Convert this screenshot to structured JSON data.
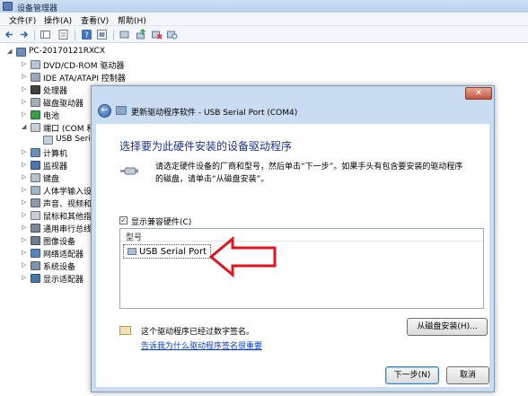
{
  "window": {
    "title": "设备管理器"
  },
  "menu": {
    "items": [
      "文件(F)",
      "操作(A)",
      "查看(V)",
      "帮助(H)"
    ]
  },
  "tree": {
    "root": "PC-20170121RXCX",
    "items": [
      {
        "label": "DVD/CD-ROM 驱动器",
        "expander": "▷"
      },
      {
        "label": "IDE ATA/ATAPI 控制器",
        "expander": "▷"
      },
      {
        "label": "处理器",
        "expander": "▷"
      },
      {
        "label": "磁盘驱动器",
        "expander": "▷"
      },
      {
        "label": "电池",
        "expander": "▷"
      },
      {
        "label": "端口 (COM 和",
        "expander": "◢"
      },
      {
        "label": "USB Seri",
        "expander": "",
        "child": true
      },
      {
        "label": "计算机",
        "expander": "▷"
      },
      {
        "label": "监视器",
        "expander": "▷"
      },
      {
        "label": "键盘",
        "expander": "▷"
      },
      {
        "label": "人体学输入设",
        "expander": "▷"
      },
      {
        "label": "声音、视频和",
        "expander": "▷"
      },
      {
        "label": "鼠标和其他指",
        "expander": "▷"
      },
      {
        "label": "通用串行总线",
        "expander": "▷"
      },
      {
        "label": "图像设备",
        "expander": "▷"
      },
      {
        "label": "网络适配器",
        "expander": "▷"
      },
      {
        "label": "系统设备",
        "expander": "▷"
      },
      {
        "label": "显示适配器",
        "expander": "▷"
      }
    ]
  },
  "dialog": {
    "close_glyph": "✕",
    "back_glyph": "←",
    "title": "更新驱动程序软件 - USB Serial Port (COM4)",
    "heading": "选择要为此硬件安装的设备驱动程序",
    "instruction": "请选定硬件设备的厂商和型号，然后单击“下一步”。如果手头有包含要安装的驱动程序的磁盘，请单击“从磁盘安装”。",
    "show_compatible": {
      "label": "显示兼容硬件(C)",
      "checked": true,
      "glyph": "✓"
    },
    "model_list": {
      "header": "型号",
      "items": [
        "USB Serial Port"
      ]
    },
    "signed_text": "这个驱动程序已经过数字签名。",
    "signed_link": "告诉我为什么驱动程序签名很重要",
    "buttons": {
      "have_disk": "从磁盘安装(H)...",
      "next": "下一步(N)",
      "cancel": "取消"
    }
  },
  "colors": {
    "heading": "#1e3287",
    "link": "#0a3cc2",
    "arrow": "#e0141e"
  },
  "icons": {
    "toolbar": [
      "back-arrow-icon",
      "forward-arrow-icon",
      "show-hide-tree-icon",
      "properties-icon",
      "help-icon",
      "device-view-icon",
      "update-driver-icon",
      "uninstall-icon",
      "scan-hardware-icon"
    ]
  }
}
